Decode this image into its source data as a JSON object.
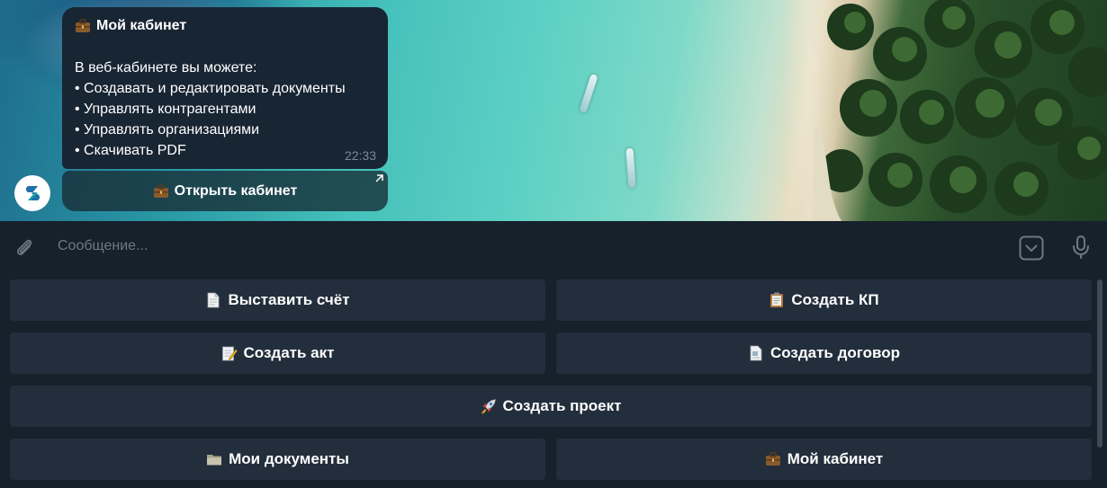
{
  "message": {
    "title": "Мой кабинет",
    "title_icon": "briefcase-icon",
    "lines": [
      "В веб-кабинете вы можете:",
      "• Создавать и редактировать документы",
      "• Управлять контрагентами",
      "• Управлять организациями",
      "• Скачивать PDF"
    ],
    "time": "22:33"
  },
  "inline_button": {
    "label": "Открыть кабинет",
    "icon": "briefcase-icon"
  },
  "composer": {
    "placeholder": "Сообщение..."
  },
  "keyboard": {
    "rows": [
      [
        {
          "label": "Выставить счёт",
          "icon": "page-icon"
        },
        {
          "label": "Создать КП",
          "icon": "clipboard-icon"
        }
      ],
      [
        {
          "label": "Создать акт",
          "icon": "memo-icon"
        },
        {
          "label": "Создать договор",
          "icon": "document-icon"
        }
      ],
      [
        {
          "label": "Создать проект",
          "icon": "rocket-icon"
        }
      ],
      [
        {
          "label": "Мои документы",
          "icon": "folder-icon"
        },
        {
          "label": "Мой кабинет",
          "icon": "briefcase-icon"
        }
      ]
    ]
  },
  "colors": {
    "panel": "#17212b",
    "bubble": "#182533",
    "button": "#222e3b",
    "accent": "#2b5278"
  }
}
